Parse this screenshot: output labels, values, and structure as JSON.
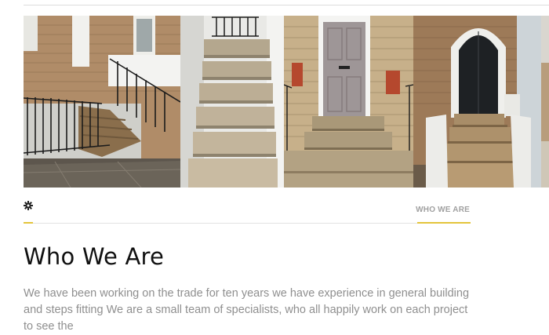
{
  "gallery": {
    "photos": [
      {
        "icon": "house-steps-photo-icon"
      },
      {
        "icon": "stone-stairs-photo-icon"
      },
      {
        "icon": "front-door-steps-photo-icon"
      },
      {
        "icon": "arched-door-steps-photo-icon"
      },
      {
        "icon": "partial-photo-icon"
      }
    ]
  },
  "tabs": {
    "settings_icon": "gear-icon",
    "items": [
      {
        "label": "WHO WE ARE",
        "active": true
      }
    ]
  },
  "section": {
    "title": "Who We Are",
    "body": "We have been working on the trade for ten years we have experience in general building and steps fitting We are a small team of specialists, who all happily work on each project to see the"
  },
  "colors": {
    "accent": "#e3c43b",
    "heading": "#111111",
    "body_text": "#8f8f8f",
    "tab_text": "#a0a0a0",
    "divider": "#e2e2e2"
  }
}
